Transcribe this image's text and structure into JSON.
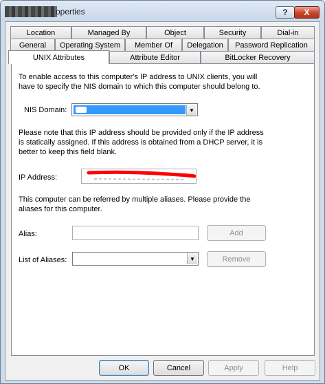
{
  "window": {
    "title_visible": "operties",
    "help_glyph": "?",
    "close_glyph": "X"
  },
  "tabs": {
    "row1": [
      "Location",
      "Managed By",
      "Object",
      "Security",
      "Dial-in"
    ],
    "row2": [
      "General",
      "Operating System",
      "Member Of",
      "Delegation",
      "Password Replication"
    ],
    "row3": [
      "UNIX Attributes",
      "Attribute Editor",
      "BitLocker Recovery"
    ],
    "active": "UNIX Attributes"
  },
  "unix": {
    "intro": "To enable access to this computer's IP address to UNIX clients, you will have to specify the NIS domain to which this computer should belong to.",
    "nis_label": "NIS Domain:",
    "nis_value": "",
    "ip_note": "Please note that this IP address should be provided only if the IP address is statically assigned. If this address is obtained from a DHCP server, it is better to keep this field blank.",
    "ip_label": "IP Address:",
    "ip_value": "",
    "alias_note": "This computer can be referred by multiple aliases. Please provide the aliases for this computer.",
    "alias_label": "Alias:",
    "alias_value": "",
    "add_label": "Add",
    "list_label": "List of Aliases:",
    "list_value": "",
    "remove_label": "Remove"
  },
  "footer": {
    "ok_label": "OK",
    "cancel_label": "Cancel",
    "apply_label": "Apply",
    "help_label": "Help"
  },
  "colors": {
    "selection": "#3399ff",
    "redaction": "#ff0000",
    "close_button": "#c9452a"
  }
}
